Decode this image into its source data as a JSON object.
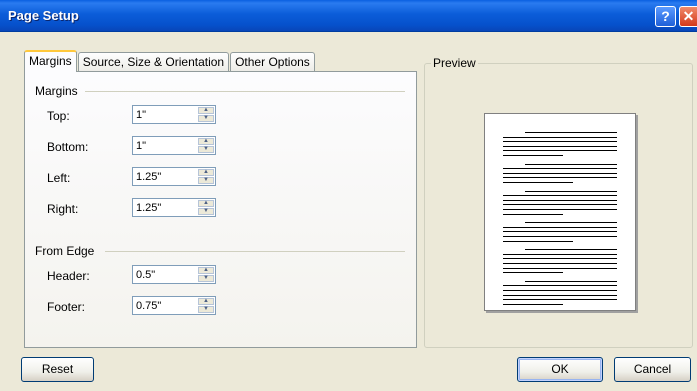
{
  "window": {
    "title": "Page Setup"
  },
  "tabs": [
    "Margins",
    "Source, Size & Orientation",
    "Other Options"
  ],
  "margins_group": {
    "label": "Margins",
    "fields": [
      {
        "label": "Top:",
        "value": "1\""
      },
      {
        "label": "Bottom:",
        "value": "1\""
      },
      {
        "label": "Left:",
        "value": "1.25\""
      },
      {
        "label": "Right:",
        "value": "1.25\""
      }
    ]
  },
  "edge_group": {
    "label": "From Edge",
    "fields": [
      {
        "label": "Header:",
        "value": "0.5\""
      },
      {
        "label": "Footer:",
        "value": "0.75\""
      }
    ]
  },
  "preview": {
    "label": "Preview"
  },
  "buttons": {
    "reset": "Reset",
    "ok": "OK",
    "cancel": "Cancel"
  },
  "icons": {
    "help": "help-icon",
    "close": "close-icon",
    "spin_up": "arrow-up-icon",
    "spin_down": "arrow-down-icon"
  }
}
